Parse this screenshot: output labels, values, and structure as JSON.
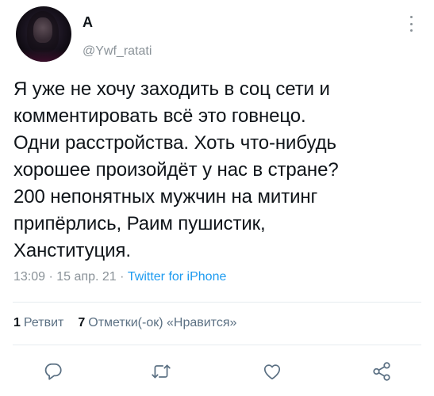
{
  "user": {
    "name": "А",
    "handle": "@Ywf_ratati"
  },
  "tweet": {
    "text": "Я уже не хочу заходить в соц сети и\nкомментировать всё это говнецо.\nОдни расстройства. Хоть что-нибудь\nхорошее произойдёт у нас в стране?\n200 непонятных мужчин на митинг\nприпёрлись, Раим пушистик,\nХанституция.",
    "time": "13:09",
    "separator1": " · ",
    "date": "15 апр. 21",
    "separator2": " · ",
    "source": "Twitter for iPhone"
  },
  "stats": {
    "retweets_count": "1",
    "retweets_label": "Ретвит",
    "likes_count": "7",
    "likes_label": "Отметки(-ок) «Нравится»"
  },
  "actions": {
    "reply_icon": "reply-icon",
    "retweet_icon": "retweet-icon",
    "like_icon": "heart-icon",
    "share_icon": "share-icon"
  },
  "colors": {
    "text": "#0f1419",
    "muted": "#8a9298",
    "link": "#1d9bf0",
    "divider": "#e6ecf0"
  }
}
